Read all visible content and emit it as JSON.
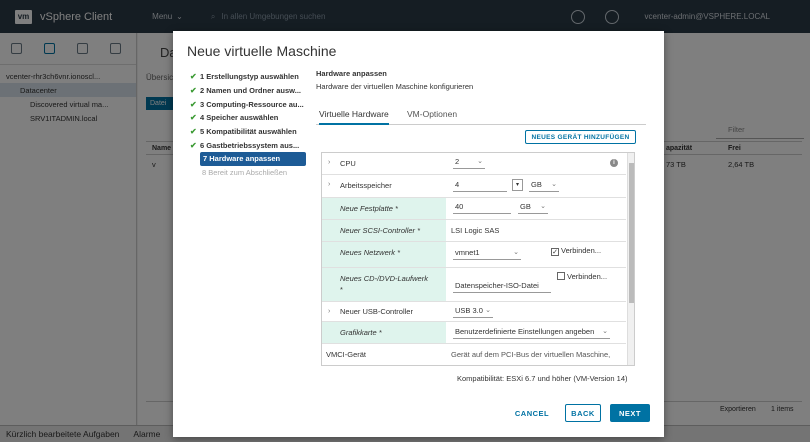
{
  "topbar": {
    "logo": "vm",
    "app_title": "vSphere Client",
    "menu_label": "Menu",
    "search_placeholder": "In allen Umgebungen suchen",
    "user": "vcenter-admin@VSPHERE.LOCAL"
  },
  "background": {
    "tree": [
      {
        "label": "vcenter-rhr3ch6vnr.ionoscl..."
      },
      {
        "label": "Datacenter"
      },
      {
        "label": "Discovered virtual ma..."
      },
      {
        "label": "SRV1ITADMIN.local"
      }
    ],
    "page_title": "Da",
    "tab": "Übersic",
    "button": "Datei",
    "filter_placeholder": "Filter",
    "col_name": "Name",
    "col_capacity": "apazität",
    "col_free": "Frei",
    "row_capacity": "73 TB",
    "row_free": "2,64 TB",
    "row_vm": "v",
    "export_label": "Exportieren",
    "items_count": "1 items"
  },
  "bottom_bar": {
    "recent_tasks": "Kürzlich bearbeitete Aufgaben",
    "alarms": "Alarme"
  },
  "modal": {
    "title": "Neue virtuelle Maschine",
    "steps": [
      {
        "label": "1 Erstellungstyp auswählen",
        "done": true
      },
      {
        "label": "2 Namen und Ordner ausw...",
        "done": true
      },
      {
        "label": "3 Computing-Ressource au...",
        "done": true
      },
      {
        "label": "4 Speicher auswählen",
        "done": true
      },
      {
        "label": "5 Kompatibilität auswählen",
        "done": true
      },
      {
        "label": "6 Gastbetriebssystem aus...",
        "done": true
      },
      {
        "label": "7 Hardware anpassen",
        "done": false,
        "active": true
      },
      {
        "label": "8 Bereit zum Abschließen",
        "done": false
      }
    ],
    "section_title": "Hardware anpassen",
    "section_subtitle": "Hardware der virtuellen Maschine konfigurieren",
    "tabs": [
      "Virtuelle Hardware",
      "VM-Optionen"
    ],
    "add_device_button": "NEUES GERÄT HINZUFÜGEN",
    "hardware": {
      "cpu": {
        "label": "CPU",
        "value": "2"
      },
      "memory": {
        "label": "Arbeitsspeicher",
        "value": "4",
        "unit": "GB"
      },
      "disk": {
        "label": "Neue Festplatte *",
        "value": "40",
        "unit": "GB"
      },
      "scsi": {
        "label": "Neuer SCSI-Controller *",
        "value": "LSI Logic SAS"
      },
      "network": {
        "label": "Neues Netzwerk *",
        "value": "vmnet1",
        "connect_label": "Verbinden...",
        "connected": true
      },
      "cdrom": {
        "label": "Neues CD-/DVD-Laufwerk",
        "label_suffix": "*",
        "value": "Datenspeicher-ISO-Datei",
        "connect_label": "Verbinden...",
        "connected": false
      },
      "usb": {
        "label": "Neuer USB-Controller",
        "value": "USB 3.0"
      },
      "graphics": {
        "label": "Grafikkarte *",
        "value": "Benutzerdefinierte Einstellungen angeben"
      },
      "vmci": {
        "label": "VMCI-Gerät",
        "value": "Gerät auf dem PCI-Bus der virtuellen Maschine,"
      }
    },
    "compatibility": "Kompatibilität: ESXi 6.7 und höher (VM-Version 14)",
    "cancel_button": "CANCEL",
    "back_button": "BACK",
    "next_button": "NEXT"
  }
}
